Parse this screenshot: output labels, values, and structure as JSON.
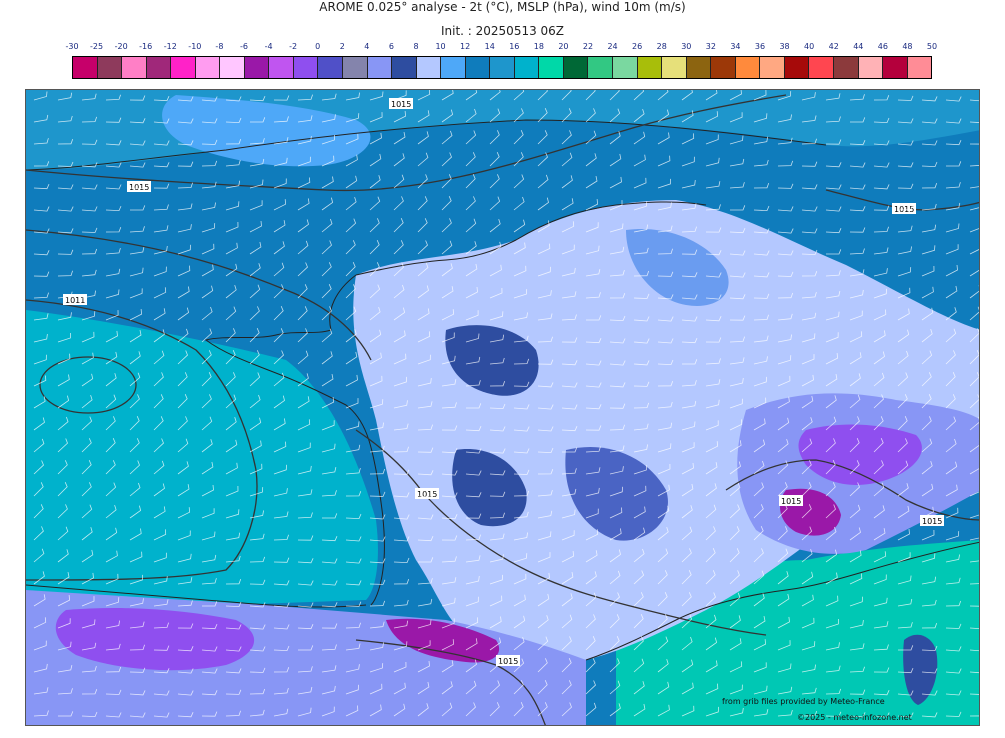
{
  "title": "AROME 0.025° analyse - 2t (°C), MSLP (hPa), wind 10m (m/s)",
  "init": "Init. : 20250513 06Z",
  "legend": {
    "labels": [
      "-30",
      "-25",
      "-20",
      "-16",
      "-12",
      "-10",
      "-8",
      "-6",
      "-4",
      "-2",
      "0",
      "2",
      "4",
      "6",
      "8",
      "10",
      "12",
      "14",
      "16",
      "18",
      "20",
      "22",
      "24",
      "26",
      "28",
      "30",
      "32",
      "34",
      "36",
      "38",
      "40",
      "42",
      "44",
      "46",
      "48",
      "50"
    ],
    "colors": [
      "#c6006a",
      "#8e3a5c",
      "#ff7fc6",
      "#a0287a",
      "#ff22c8",
      "#ff9cf0",
      "#ffc6ff",
      "#9a18a8",
      "#c055f0",
      "#8f4fef",
      "#5050c8",
      "#8484ac",
      "#8896f5",
      "#2e4da0",
      "#b4c8ff",
      "#4ea8f8",
      "#0f7cbc",
      "#1e96cc",
      "#00b2cc",
      "#00d8a8",
      "#006836",
      "#32c883",
      "#7ad8a0",
      "#a8be0a",
      "#e6e07a",
      "#8c6410",
      "#9c3808",
      "#ff8a3c",
      "#ffa882",
      "#a60a0a",
      "#ff4650",
      "#8c3a3c",
      "#ffb2b6",
      "#b4003c",
      "#ff8c96"
    ]
  },
  "isobars": [
    "1015",
    "1015",
    "1011",
    "1015",
    "1015",
    "1015",
    "1015",
    "1015"
  ],
  "credit": "from grib files provided by Meteo-France",
  "copyright": "©2025 - meteo-infozone.net"
}
